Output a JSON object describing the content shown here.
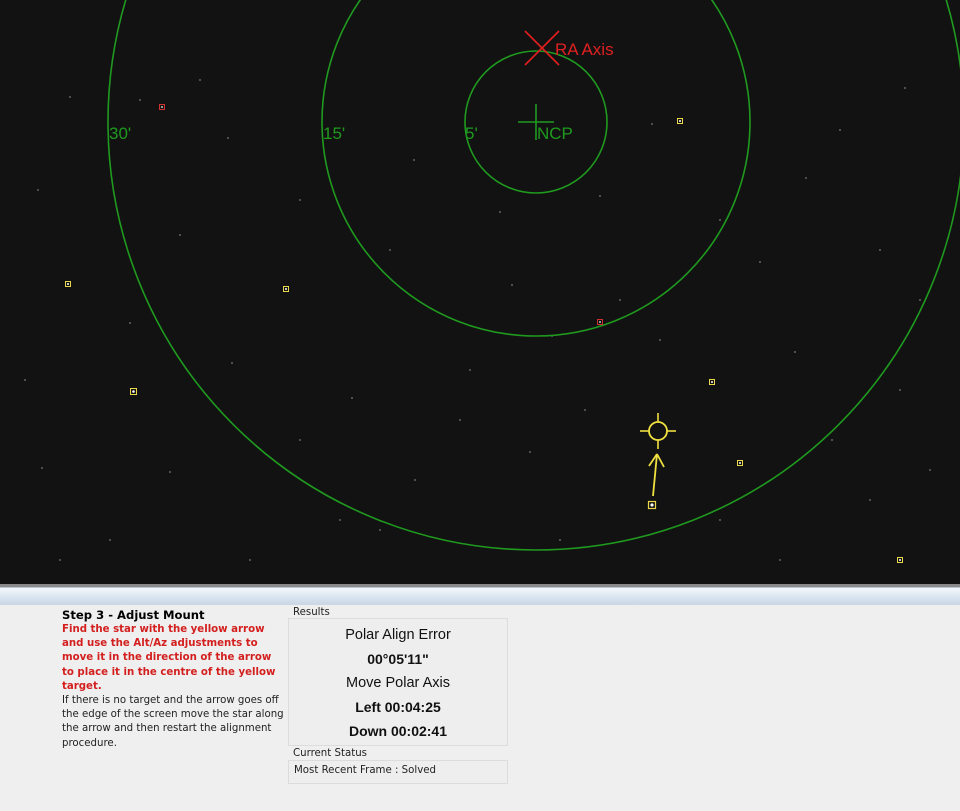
{
  "sky_view": {
    "ra_axis_label": "RA Axis",
    "ncp_label": "NCP",
    "ring_labels": [
      "5'",
      "15'",
      "30'"
    ],
    "colors": {
      "background": "#121212",
      "rings": "#1f9a1f",
      "ra_axis": "#e02020",
      "target": "#f0e040",
      "star_marker": "#e8d84a",
      "rejected_star": "#d03030"
    }
  },
  "step": {
    "title": "Step 3 - Adjust Mount",
    "instruction": "Find the star with the yellow arrow and use the Alt/Az adjustments to move it in the direction of the arrow to place it in the centre of the yellow target.",
    "note": "If there is no target and the arrow goes off the edge of the screen move the star along the arrow and then restart the alignment procedure."
  },
  "results": {
    "label": "Results",
    "title": "Polar Align Error",
    "error_value": "00°05'11\"",
    "move_label": "Move Polar Axis",
    "left_value": "Left 00:04:25",
    "down_value": "Down 00:02:41"
  },
  "status": {
    "label": "Current Status",
    "text": "Most Recent Frame : Solved"
  }
}
